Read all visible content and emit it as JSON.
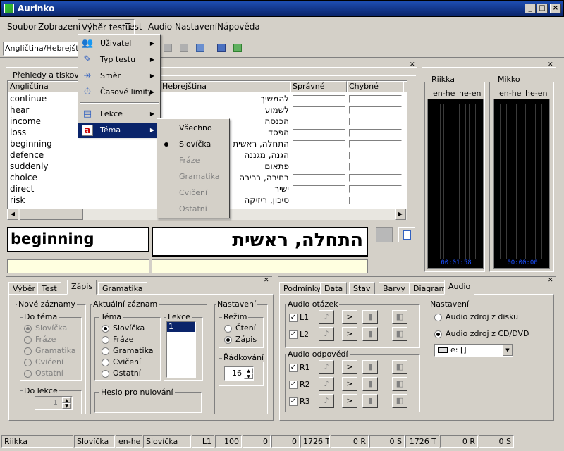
{
  "window": {
    "title": "Aurinko"
  },
  "menubar": [
    "Soubor",
    "Zobrazení",
    "Výběr testu",
    "Test",
    "Audio",
    "Nastavení",
    "Nápověda"
  ],
  "toolbar": {
    "course": "Angličtina/Hebrejština"
  },
  "panel": {
    "title": "Přehledy a tiskové"
  },
  "table": {
    "headers": [
      "Angličtina",
      "Hebrejština",
      "Správné",
      "Chybné"
    ],
    "rows": [
      {
        "en": "continue",
        "he": "להמשיך"
      },
      {
        "en": "hear",
        "he": "לשמוע"
      },
      {
        "en": "income",
        "he": "הכנסה"
      },
      {
        "en": "loss",
        "he": "הפסד"
      },
      {
        "en": "beginning",
        "he": "התחלה, ראשית"
      },
      {
        "en": "defence",
        "he": "הגנה, מגננה"
      },
      {
        "en": "suddenly",
        "he": "פתאום"
      },
      {
        "en": "choice",
        "he": "בחירה, ברירה"
      },
      {
        "en": "direct",
        "he": "ישיר"
      },
      {
        "en": "risk",
        "he": "סיכון, ריזיקה"
      }
    ]
  },
  "word": {
    "en": "beginning",
    "he": "התחלה, ראשית"
  },
  "meters": {
    "a": {
      "name": "Riikka",
      "ch1": "en-he",
      "ch2": "he-en",
      "time": "00:01:58"
    },
    "b": {
      "name": "Mikko",
      "ch1": "en-he",
      "ch2": "he-en",
      "time": "00:00:00"
    }
  },
  "menu": {
    "items": [
      {
        "icon": "users-icon",
        "label": "Uživatel"
      },
      {
        "icon": "test-type-icon",
        "label": "Typ testu"
      },
      {
        "icon": "direction-icon",
        "label": "Směr"
      },
      {
        "icon": "time-limit-icon",
        "label": "Časové limity"
      },
      {
        "icon": "lessons-icon",
        "label": "Lekce"
      },
      {
        "icon": "topic-icon",
        "label": "Téma"
      }
    ],
    "submenu": [
      "Všechno",
      "Slovíčka",
      "Fráze",
      "Gramatika",
      "Cvičení",
      "Ostatní"
    ]
  },
  "left_tabs": [
    "Výběr",
    "Test",
    "Zápis",
    "Gramatika"
  ],
  "zapis": {
    "new_group": "Nové záznamy",
    "do_tema": "Do téma",
    "do_tema_opts": [
      "Slovíčka",
      "Fráze",
      "Gramatika",
      "Cvičení",
      "Ostatní"
    ],
    "do_lekce": "Do lekce",
    "do_lekce_val": "1",
    "current_group": "Aktuální záznam",
    "tema": "Téma",
    "tema_opts": [
      "Slovíčka",
      "Fráze",
      "Gramatika",
      "Cvičení",
      "Ostatní"
    ],
    "lekce": "Lekce",
    "lekce_val": "1",
    "heslo": "Heslo pro nulování",
    "settings": "Nastavení",
    "rezim": "Režim",
    "rezim_opts": [
      "Čtení",
      "Zápis"
    ],
    "radkovani": "Řádkování",
    "radkovani_val": "16"
  },
  "right_tabs": [
    "Podmínky",
    "Data",
    "Stav",
    "Barvy",
    "Diagram",
    "Audio"
  ],
  "audio": {
    "otazek": "Audio otázek",
    "odpovedi": "Audio odpovědí",
    "q": [
      "L1",
      "L2"
    ],
    "a": [
      "R1",
      "R2",
      "R3"
    ],
    "settings": "Nastavení",
    "opt1": "Audio zdroj z disku",
    "opt2": "Audio zdroj z CD/DVD",
    "drive": "e: []"
  },
  "status": [
    "Riikka",
    "Slovíčka",
    "en-he",
    "Slovíčka",
    "L1",
    "100",
    "0",
    "0",
    "1726 T",
    "0 R",
    "0 S",
    "1726 T",
    "0 R",
    "0 S"
  ]
}
